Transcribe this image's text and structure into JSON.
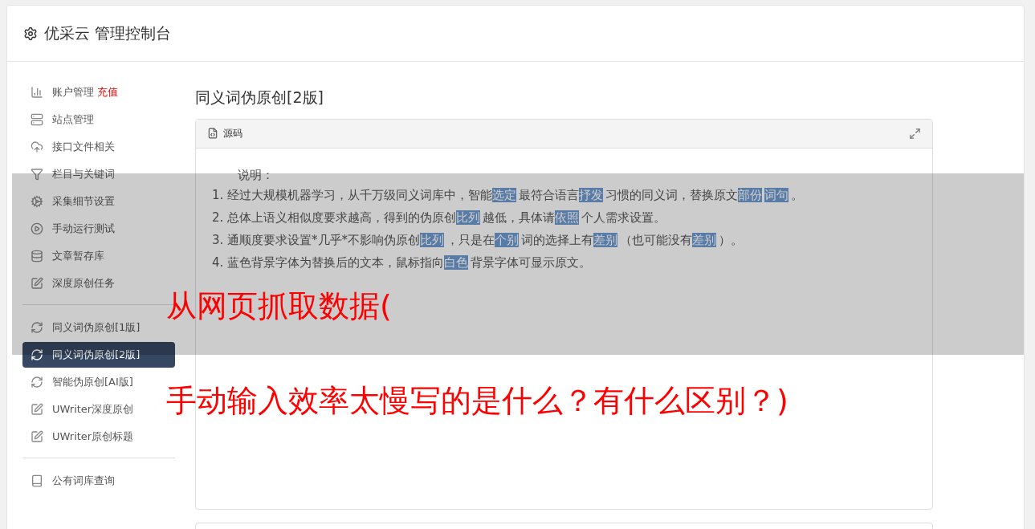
{
  "header": {
    "title": "优采云 管理控制台"
  },
  "sidebar": {
    "groups": [
      {
        "items": [
          {
            "label": "账户管理",
            "badge": "充值",
            "selected": false
          },
          {
            "label": "站点管理",
            "selected": false
          },
          {
            "label": "接口文件相关",
            "selected": false
          },
          {
            "label": "栏目与关键词",
            "selected": false
          },
          {
            "label": "采集细节设置",
            "selected": false
          },
          {
            "label": "手动运行测试",
            "selected": false
          },
          {
            "label": "文章暂存库",
            "selected": false
          },
          {
            "label": "深度原创任务",
            "selected": false
          }
        ]
      },
      {
        "items": [
          {
            "label": "同义词伪原创[1版]",
            "selected": false
          },
          {
            "label": "同义词伪原创[2版]",
            "selected": true
          },
          {
            "label": "智能伪原创[AI版]",
            "selected": false
          },
          {
            "label": "UWriter深度原创",
            "selected": false
          },
          {
            "label": "UWriter原创标题",
            "selected": false
          }
        ]
      },
      {
        "items": [
          {
            "label": "公有词库查询",
            "selected": false
          }
        ]
      }
    ]
  },
  "content": {
    "title": "同义词伪原创[2版]",
    "editor": {
      "tab": "源码",
      "heading": "说明：",
      "lines": [
        [
          {
            "text": "1. 经过大规模机器学习，从千万级同义词库中，智能",
            "highlighted": false
          },
          {
            "text": "选定",
            "highlighted": true
          },
          {
            "text": "最符合语言",
            "highlighted": false
          },
          {
            "text": "抒发",
            "highlighted": true
          },
          {
            "text": "习惯的同义词，替换原文",
            "highlighted": false
          },
          {
            "text": "部份",
            "highlighted": true
          },
          {
            "text": "词句",
            "highlighted": true
          },
          {
            "text": "。",
            "highlighted": false
          }
        ],
        [
          {
            "text": "2. 总体上语义相似度要求越高，得到的伪原创",
            "highlighted": false
          },
          {
            "text": "比列",
            "highlighted": true
          },
          {
            "text": "越低，具体请",
            "highlighted": false
          },
          {
            "text": "依照",
            "highlighted": true
          },
          {
            "text": "个人需求设置。",
            "highlighted": false
          }
        ],
        [
          {
            "text": "3. 通顺度要求设置*几乎*不影响伪原创",
            "highlighted": false
          },
          {
            "text": "比列",
            "highlighted": true
          },
          {
            "text": "，只是在",
            "highlighted": false
          },
          {
            "text": "个别",
            "highlighted": true
          },
          {
            "text": "词的选择上有",
            "highlighted": false
          },
          {
            "text": "差别",
            "highlighted": true
          },
          {
            "text": "（也可能没有",
            "highlighted": false
          },
          {
            "text": "差别",
            "highlighted": true
          },
          {
            "text": "）。",
            "highlighted": false
          }
        ],
        [
          {
            "text": "4. 蓝色背景字体为替换后的文本，鼠标指向",
            "highlighted": false
          },
          {
            "text": "白色",
            "highlighted": true
          },
          {
            "text": "背景字体可显示原文。",
            "highlighted": false
          }
        ]
      ]
    }
  },
  "overlay_caption": [
    "从网页抓取数据(",
    "手动输入效率太慢写的是什么？有什么区别？)"
  ]
}
